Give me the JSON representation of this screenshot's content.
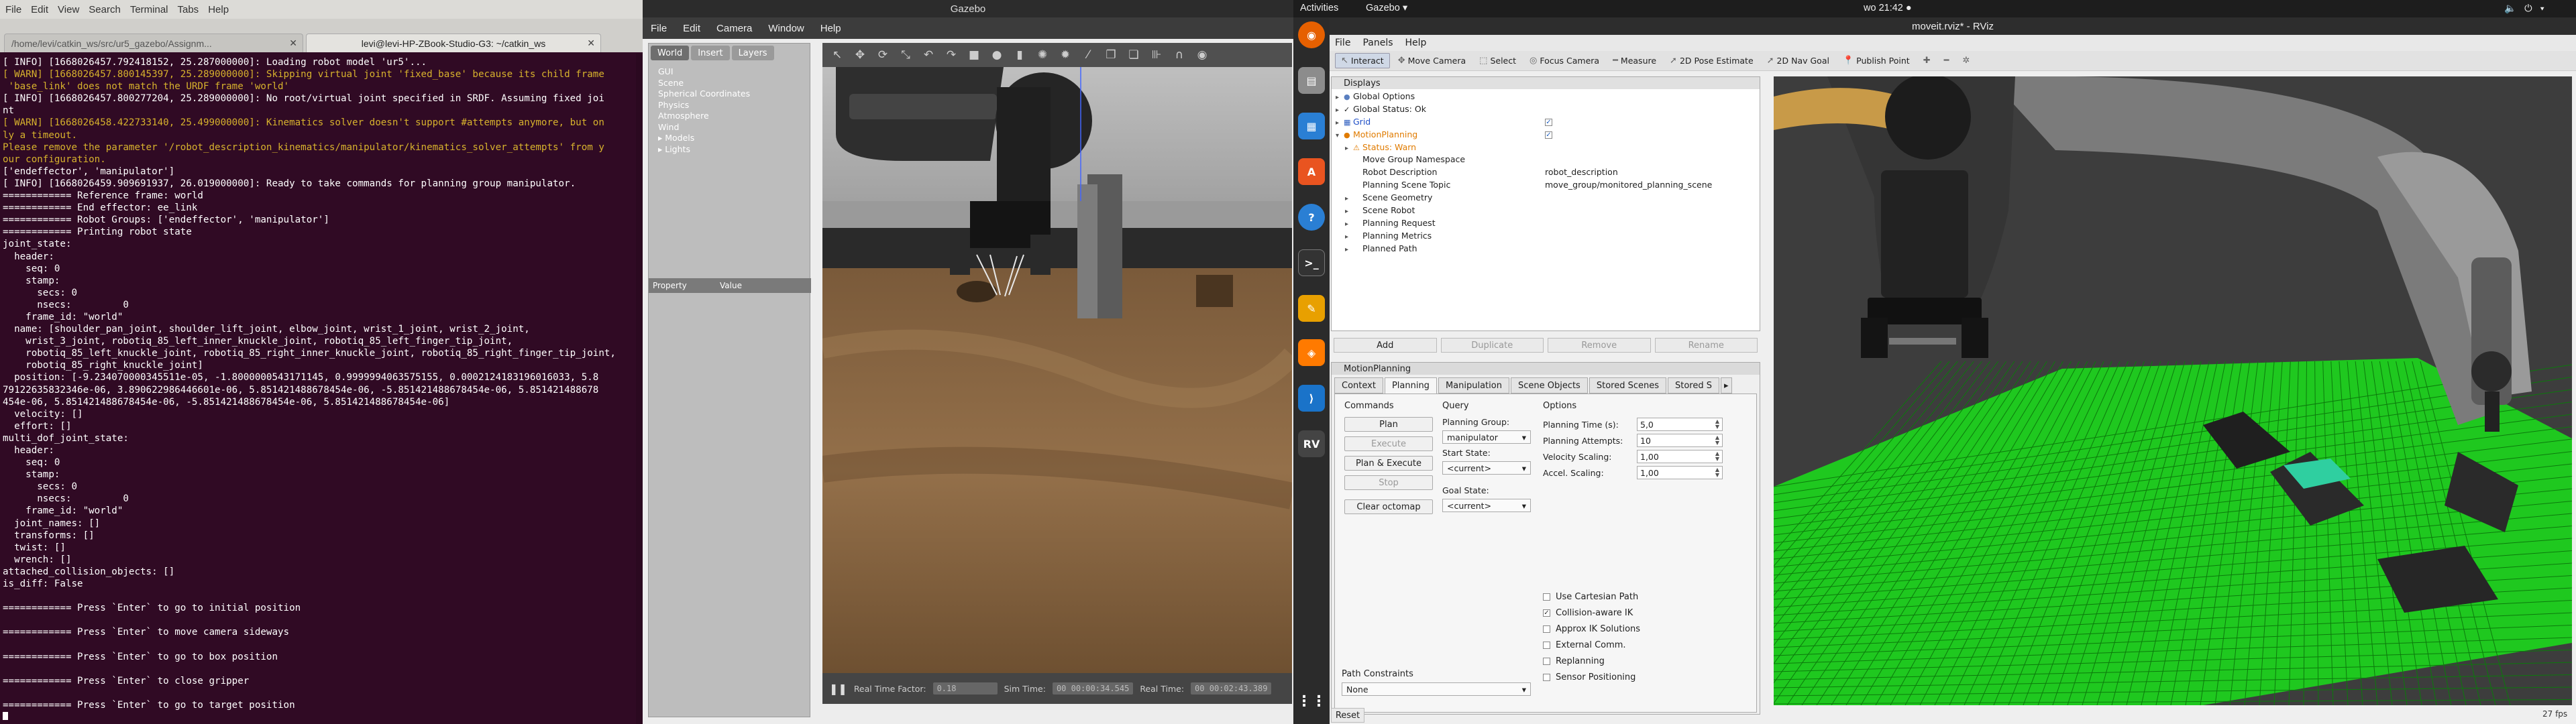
{
  "terminal": {
    "menu": [
      "File",
      "Edit",
      "View",
      "Search",
      "Terminal",
      "Tabs",
      "Help"
    ],
    "window_title": "levi@levi-HP-ZBook-Studio-G3: ~/catkin_ws",
    "tabs": [
      {
        "label": "/home/levi/catkin_ws/src/ur5_gazebo/Assignm..."
      },
      {
        "label": "levi@levi-HP-ZBook-Studio-G3: ~/catkin_ws"
      }
    ],
    "lines": [
      {
        "t": "[ INFO] [1668026457.792418152, 25.287000000]: Loading robot model 'ur5'...",
        "k": "info"
      },
      {
        "t": "[ WARN] [1668026457.800145397, 25.289000000]: Skipping virtual joint 'fixed_base' because its child frame",
        "k": "warn"
      },
      {
        "t": " 'base_link' does not match the URDF frame 'world'",
        "k": "warn"
      },
      {
        "t": "[ INFO] [1668026457.800277204, 25.289000000]: No root/virtual joint specified in SRDF. Assuming fixed joi",
        "k": "info"
      },
      {
        "t": "nt",
        "k": "info"
      },
      {
        "t": "[ WARN] [1668026458.422733140, 25.499000000]: Kinematics solver doesn't support #attempts anymore, but on",
        "k": "warn"
      },
      {
        "t": "ly a timeout.",
        "k": "warn"
      },
      {
        "t": "Please remove the parameter '/robot_description_kinematics/manipulator/kinematics_solver_attempts' from y",
        "k": "warn"
      },
      {
        "t": "our configuration.",
        "k": "warn"
      },
      {
        "t": "['endeffector', 'manipulator']",
        "k": "info"
      },
      {
        "t": "[ INFO] [1668026459.909691937, 26.019000000]: Ready to take commands for planning group manipulator.",
        "k": "info"
      },
      {
        "t": "============ Reference frame: world",
        "k": "info"
      },
      {
        "t": "============ End effector: ee_link",
        "k": "info"
      },
      {
        "t": "============ Robot Groups: ['endeffector', 'manipulator']",
        "k": "info"
      },
      {
        "t": "============ Printing robot state",
        "k": "info"
      },
      {
        "t": "joint_state:",
        "k": "info"
      },
      {
        "t": "  header:",
        "k": "info"
      },
      {
        "t": "    seq: 0",
        "k": "info"
      },
      {
        "t": "    stamp:",
        "k": "info"
      },
      {
        "t": "      secs: 0",
        "k": "info"
      },
      {
        "t": "      nsecs:         0",
        "k": "info"
      },
      {
        "t": "    frame_id: \"world\"",
        "k": "info"
      },
      {
        "t": "  name: [shoulder_pan_joint, shoulder_lift_joint, elbow_joint, wrist_1_joint, wrist_2_joint,",
        "k": "info"
      },
      {
        "t": "    wrist_3_joint, robotiq_85_left_inner_knuckle_joint, robotiq_85_left_finger_tip_joint,",
        "k": "info"
      },
      {
        "t": "    robotiq_85_left_knuckle_joint, robotiq_85_right_inner_knuckle_joint, robotiq_85_right_finger_tip_joint,",
        "k": "info"
      },
      {
        "t": "    robotiq_85_right_knuckle_joint]",
        "k": "info"
      },
      {
        "t": "  position: [-9.234070000345511e-05, -1.8000000543171145, 0.9999994063575155, 0.0002124183196016033, 5.8",
        "k": "info"
      },
      {
        "t": "79122635832346e-06, 3.890622986446601e-06, 5.851421488678454e-06, -5.851421488678454e-06, 5.851421488678",
        "k": "info"
      },
      {
        "t": "454e-06, 5.851421488678454e-06, -5.851421488678454e-06, 5.851421488678454e-06]",
        "k": "info"
      },
      {
        "t": "  velocity: []",
        "k": "info"
      },
      {
        "t": "  effort: []",
        "k": "info"
      },
      {
        "t": "multi_dof_joint_state:",
        "k": "info"
      },
      {
        "t": "  header:",
        "k": "info"
      },
      {
        "t": "    seq: 0",
        "k": "info"
      },
      {
        "t": "    stamp:",
        "k": "info"
      },
      {
        "t": "      secs: 0",
        "k": "info"
      },
      {
        "t": "      nsecs:         0",
        "k": "info"
      },
      {
        "t": "    frame_id: \"world\"",
        "k": "info"
      },
      {
        "t": "  joint_names: []",
        "k": "info"
      },
      {
        "t": "  transforms: []",
        "k": "info"
      },
      {
        "t": "  twist: []",
        "k": "info"
      },
      {
        "t": "  wrench: []",
        "k": "info"
      },
      {
        "t": "attached_collision_objects: []",
        "k": "info"
      },
      {
        "t": "is_diff: False",
        "k": "info"
      },
      {
        "t": "",
        "k": "info"
      },
      {
        "t": "============ Press `Enter` to go to initial position",
        "k": "info"
      },
      {
        "t": "",
        "k": "info"
      },
      {
        "t": "============ Press `Enter` to move camera sideways",
        "k": "info"
      },
      {
        "t": "",
        "k": "info"
      },
      {
        "t": "============ Press `Enter` to go to box position",
        "k": "info"
      },
      {
        "t": "",
        "k": "info"
      },
      {
        "t": "============ Press `Enter` to close gripper",
        "k": "info"
      },
      {
        "t": "",
        "k": "info"
      },
      {
        "t": "============ Press `Enter` to go to target position",
        "k": "info"
      }
    ]
  },
  "topbar": {
    "activities": "Activities",
    "app": "Gazebo ▾",
    "clock": "wo 21:42 ●",
    "status": "🔈 ⏻ ▾"
  },
  "gazebo": {
    "title": "Gazebo",
    "menu": [
      "File",
      "Edit",
      "Camera",
      "Window",
      "Help"
    ],
    "tabs": [
      "World",
      "Insert",
      "Layers"
    ],
    "tree": [
      "GUI",
      "Scene",
      "Spherical Coordinates",
      "Physics",
      "Atmosphere",
      "Wind",
      "▸ Models",
      "▸ Lights"
    ],
    "prop_headers": [
      "Property",
      "Value"
    ],
    "bottom": {
      "rtf_label": "Real Time Factor:",
      "rtf_value": "0.18",
      "sim_label": "Sim Time:",
      "sim_value": "00 00:00:34.545",
      "real_label": "Real Time:",
      "real_value": "00 00:02:43.389"
    }
  },
  "rviz": {
    "title": "moveit.rviz* - RViz",
    "menu": [
      "File",
      "Panels",
      "Help"
    ],
    "tools": [
      {
        "label": "Interact",
        "icon": "↖",
        "active": true
      },
      {
        "label": "Move Camera",
        "icon": "✥",
        "active": false
      },
      {
        "label": "Select",
        "icon": "⬚",
        "active": false
      },
      {
        "label": "Focus Camera",
        "icon": "◎",
        "active": false
      },
      {
        "label": "Measure",
        "icon": "━",
        "active": false
      },
      {
        "label": "2D Pose Estimate",
        "icon": "➚",
        "active": false
      },
      {
        "label": "2D Nav Goal",
        "icon": "➚",
        "active": false
      },
      {
        "label": "Publish Point",
        "icon": "📍",
        "active": false
      },
      {
        "label": "",
        "icon": "✚",
        "active": false
      },
      {
        "label": "",
        "icon": "━",
        "active": false
      },
      {
        "label": "",
        "icon": "✲",
        "active": false
      }
    ],
    "displays": {
      "title": "Displays",
      "rows": [
        {
          "label": "Global Options",
          "value": "",
          "indent": 0,
          "arrow": "▸",
          "icon": "●",
          "color": "#5a7fc0",
          "check": false
        },
        {
          "label": "Global Status: Ok",
          "value": "",
          "indent": 0,
          "arrow": "▸",
          "icon": "✓",
          "color": "#222",
          "check": false
        },
        {
          "label": "Grid",
          "value": "",
          "indent": 0,
          "arrow": "▸",
          "icon": "▦",
          "color": "#3060c0",
          "check": true
        },
        {
          "label": "MotionPlanning",
          "value": "",
          "indent": 0,
          "arrow": "▾",
          "icon": "●",
          "color": "#e07b00",
          "check": true
        },
        {
          "label": "Status: Warn",
          "value": "",
          "indent": 1,
          "arrow": "▸",
          "icon": "⚠",
          "color": "#e07b00",
          "check": false
        },
        {
          "label": "Move Group Namespace",
          "value": "",
          "indent": 1,
          "arrow": "",
          "icon": "",
          "color": "#222",
          "check": false
        },
        {
          "label": "Robot Description",
          "value": "robot_description",
          "indent": 1,
          "arrow": "",
          "icon": "",
          "color": "#222",
          "check": false
        },
        {
          "label": "Planning Scene Topic",
          "value": "move_group/monitored_planning_scene",
          "indent": 1,
          "arrow": "",
          "icon": "",
          "color": "#222",
          "check": false
        },
        {
          "label": "Scene Geometry",
          "value": "",
          "indent": 1,
          "arrow": "▸",
          "icon": "",
          "color": "#222",
          "check": false
        },
        {
          "label": "Scene Robot",
          "value": "",
          "indent": 1,
          "arrow": "▸",
          "icon": "",
          "color": "#222",
          "check": false
        },
        {
          "label": "Planning Request",
          "value": "",
          "indent": 1,
          "arrow": "▸",
          "icon": "",
          "color": "#222",
          "check": false
        },
        {
          "label": "Planning Metrics",
          "value": "",
          "indent": 1,
          "arrow": "▸",
          "icon": "",
          "color": "#222",
          "check": false
        },
        {
          "label": "Planned Path",
          "value": "",
          "indent": 1,
          "arrow": "▸",
          "icon": "",
          "color": "#222",
          "check": false
        }
      ],
      "buttons": [
        {
          "label": "Add",
          "enabled": true
        },
        {
          "label": "Duplicate",
          "enabled": false
        },
        {
          "label": "Remove",
          "enabled": false
        },
        {
          "label": "Rename",
          "enabled": false
        }
      ]
    },
    "motion_planning": {
      "title": "MotionPlanning",
      "tabs": [
        "Context",
        "Planning",
        "Manipulation",
        "Scene Objects",
        "Stored Scenes",
        "Stored S"
      ],
      "active_tab": "Planning",
      "commands_label": "Commands",
      "query_label": "Query",
      "options_label": "Options",
      "commands": [
        {
          "label": "Plan",
          "enabled": true
        },
        {
          "label": "Execute",
          "enabled": false
        },
        {
          "label": "Plan & Execute",
          "enabled": true
        },
        {
          "label": "Stop",
          "enabled": false
        },
        {
          "label": "Clear octomap",
          "enabled": true
        }
      ],
      "planning_group_label": "Planning Group:",
      "planning_group": "manipulator",
      "start_state_label": "Start State:",
      "start_state": "<current>",
      "goal_state_label": "Goal State:",
      "goal_state": "<current>",
      "options": [
        {
          "label": "Planning Time (s):",
          "value": "5,0"
        },
        {
          "label": "Planning Attempts:",
          "value": "10"
        },
        {
          "label": "Velocity Scaling:",
          "value": "1,00"
        },
        {
          "label": "Accel. Scaling:",
          "value": "1,00"
        }
      ],
      "checkboxes": [
        {
          "label": "Use Cartesian Path",
          "checked": false
        },
        {
          "label": "Collision-aware IK",
          "checked": true
        },
        {
          "label": "Approx IK Solutions",
          "checked": false
        },
        {
          "label": "External Comm.",
          "checked": false
        },
        {
          "label": "Replanning",
          "checked": false
        },
        {
          "label": "Sensor Positioning",
          "checked": false
        }
      ],
      "path_constraints_label": "Path Constraints",
      "path_constraints": "None"
    },
    "reset": "Reset",
    "fps": "27 fps"
  }
}
